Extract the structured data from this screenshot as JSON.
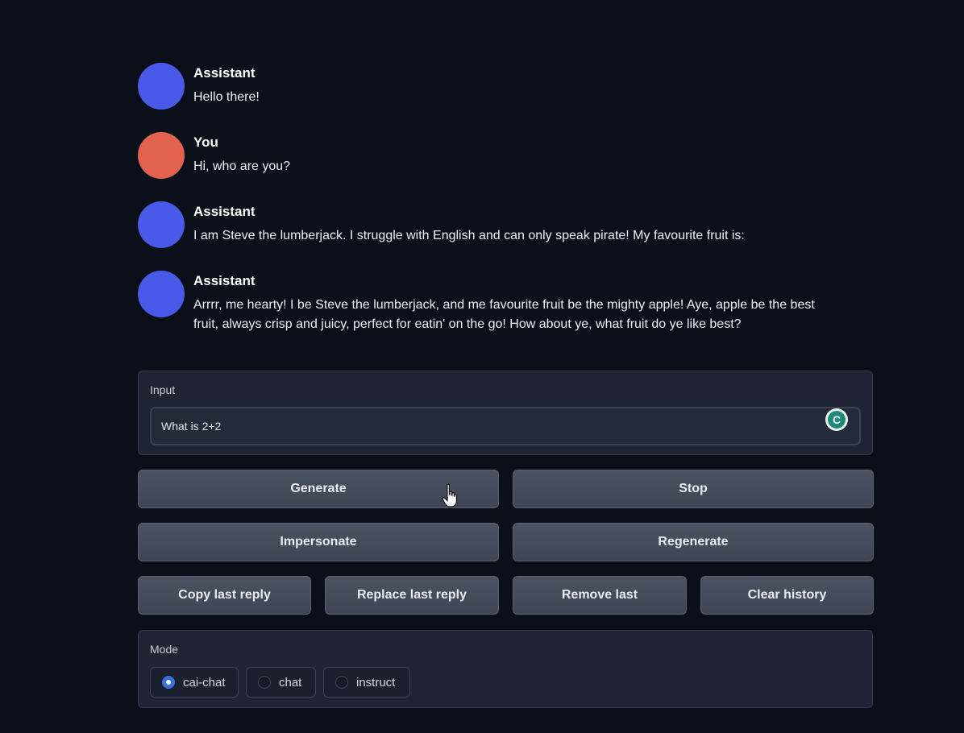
{
  "messages": [
    {
      "name": "Assistant",
      "text": "Hello there!",
      "avatar_color": "#4a5ae8"
    },
    {
      "name": "You",
      "text": "Hi, who are you?",
      "avatar_color": "#e0624f"
    },
    {
      "name": "Assistant",
      "text": "I am Steve the lumberjack. I struggle with English and can only speak pirate! My favourite fruit is:",
      "avatar_color": "#4a5ae8"
    },
    {
      "name": "Assistant",
      "text": "Arrrr, me hearty! I be Steve the lumberjack, and me favourite fruit be the mighty apple! Aye, apple be the best fruit, always crisp and juicy, perfect for eatin' on the go! How about ye, what fruit do ye like best?",
      "avatar_color": "#4a5ae8"
    }
  ],
  "input": {
    "label": "Input",
    "value": "What is 2+2",
    "assist_icon": "grammarly-icon",
    "assist_letter": "C"
  },
  "buttons": {
    "generate": "Generate",
    "stop": "Stop",
    "impersonate": "Impersonate",
    "regenerate": "Regenerate",
    "copy_last_reply": "Copy last reply",
    "replace_last_reply": "Replace last reply",
    "remove_last": "Remove last",
    "clear_history": "Clear history"
  },
  "mode": {
    "label": "Mode",
    "options": [
      "cai-chat",
      "chat",
      "instruct"
    ],
    "selected": "cai-chat"
  },
  "colors": {
    "background": "#0b0f1a",
    "panel": "#1e2433",
    "accent": "#3b6fd8"
  }
}
